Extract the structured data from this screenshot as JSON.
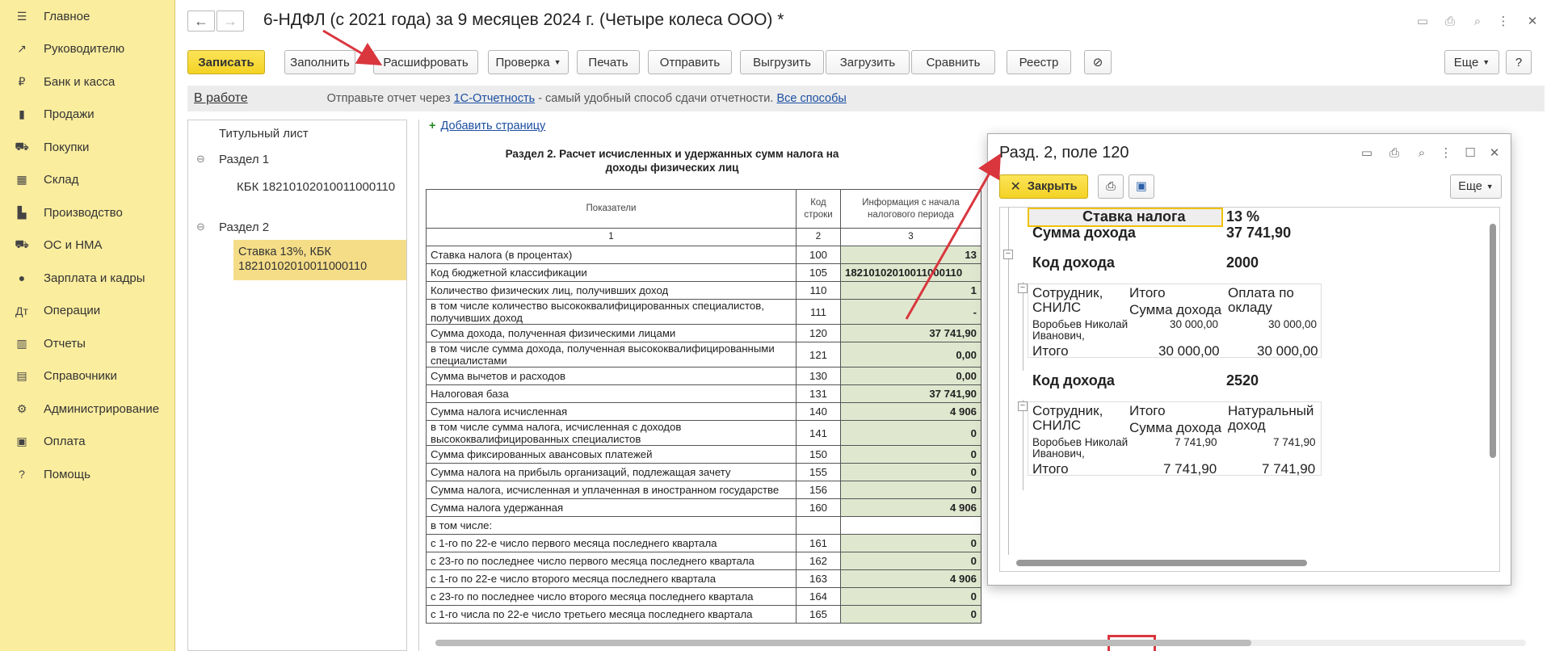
{
  "nav": {
    "items": [
      {
        "icon": "menu-icon",
        "glyph": "☰",
        "label": "Главное"
      },
      {
        "icon": "trend-icon",
        "glyph": "↗",
        "label": "Руководителю"
      },
      {
        "icon": "bank-icon",
        "glyph": "₽",
        "label": "Банк и касса"
      },
      {
        "icon": "shopping-bag-icon",
        "glyph": "▮",
        "label": "Продажи"
      },
      {
        "icon": "cart-icon",
        "glyph": "⛟",
        "label": "Покупки"
      },
      {
        "icon": "warehouse-icon",
        "glyph": "▦",
        "label": "Склад"
      },
      {
        "icon": "factory-icon",
        "glyph": "▙",
        "label": "Производство"
      },
      {
        "icon": "truck-icon",
        "glyph": "⛟",
        "label": "ОС и НМА"
      },
      {
        "icon": "person-icon",
        "glyph": "●",
        "label": "Зарплата и кадры"
      },
      {
        "icon": "operations-icon",
        "glyph": "Дт",
        "label": "Операции"
      },
      {
        "icon": "reports-icon",
        "glyph": "▥",
        "label": "Отчеты"
      },
      {
        "icon": "books-icon",
        "glyph": "▤",
        "label": "Справочники"
      },
      {
        "icon": "gear-icon",
        "glyph": "⚙",
        "label": "Администрирование"
      },
      {
        "icon": "payment-icon",
        "glyph": "▣",
        "label": "Оплата"
      },
      {
        "icon": "help-icon",
        "glyph": "?",
        "label": "Помощь"
      }
    ]
  },
  "header": {
    "title": "6-НДФЛ (с 2021 года) за 9 месяцев 2024 г. (Четыре колеса ООО) *"
  },
  "toolbar": {
    "save": "Записать",
    "fill": "Заполнить",
    "decode": "Расшифровать",
    "check": "Проверка",
    "print": "Печать",
    "send": "Отправить",
    "export": "Выгрузить",
    "import": "Загрузить",
    "compare": "Сравнить",
    "registry": "Реестр",
    "more": "Еще",
    "help": "?"
  },
  "infobar": {
    "status": "В работе",
    "msg_before": "Отправьте отчет через ",
    "link1": "1С-Отчетность",
    "msg_after": " - самый удобный способ сдачи отчетности. ",
    "link2": "Все способы"
  },
  "tree": {
    "title_page": "Титульный лист",
    "section1": "Раздел 1",
    "kbk1": "КБК 18210102010011000110",
    "section2": "Раздел 2",
    "sel_line1": "Ставка 13%, КБК",
    "sel_line2": "18210102010011000110"
  },
  "report": {
    "add_page": "Добавить страницу",
    "title": "Раздел 2. Расчет исчисленных и удержанных сумм налога на доходы физических лиц",
    "head": {
      "c1": "Показатели",
      "c2": "Код строки",
      "c3": "Информация с начала налогового периода",
      "n1": "1",
      "n2": "2",
      "n3": "3"
    },
    "rows": [
      {
        "label": "Ставка налога (в процентах)",
        "code": "100",
        "value": "13"
      },
      {
        "label": "Код бюджетной классификации",
        "code": "105",
        "value": "18210102010011000110"
      },
      {
        "label": "Количество физических лиц, получивших доход",
        "code": "110",
        "value": "1"
      },
      {
        "label": "в том числе количество высококвалифицированных специалистов, получивших доход",
        "code": "111",
        "value": "-"
      },
      {
        "label": "Сумма дохода, полученная физическими лицами",
        "code": "120",
        "value": "37 741,90"
      },
      {
        "label": "в том числе сумма дохода, полученная высококвалифицированными специалистами",
        "code": "121",
        "value": "0,00"
      },
      {
        "label": "Сумма вычетов и расходов",
        "code": "130",
        "value": "0,00"
      },
      {
        "label": "Налоговая база",
        "code": "131",
        "value": "37 741,90"
      },
      {
        "label": "Сумма налога исчисленная",
        "code": "140",
        "value": "4 906"
      },
      {
        "label": "в том числе сумма налога, исчисленная с доходов высококвалифицированных специалистов",
        "code": "141",
        "value": "0"
      },
      {
        "label": "Сумма фиксированных авансовых платежей",
        "code": "150",
        "value": "0"
      },
      {
        "label": "Сумма налога на прибыль организаций, подлежащая зачету",
        "code": "155",
        "value": "0"
      },
      {
        "label": "Сумма налога, исчисленная и уплаченная в иностранном государстве",
        "code": "156",
        "value": "0"
      },
      {
        "label": "Сумма налога удержанная",
        "code": "160",
        "value": "4 906"
      },
      {
        "label": "в том числе:",
        "code": "",
        "value": ""
      },
      {
        "label": "с 1-го по 22-е число первого месяца последнего квартала",
        "code": "161",
        "value": "0"
      },
      {
        "label": "с 23-го по последнее число первого месяца последнего квартала",
        "code": "162",
        "value": "0"
      },
      {
        "label": "с 1-го по 22-е число второго месяца последнего квартала",
        "code": "163",
        "value": "4 906"
      },
      {
        "label": "с 23-го по последнее число второго месяца последнего квартала",
        "code": "164",
        "value": "0"
      },
      {
        "label": "с 1-го числа по 22-е число третьего месяца последнего квартала",
        "code": "165",
        "value": "0"
      }
    ]
  },
  "popup": {
    "title": "Разд. 2, поле 120",
    "close": "Закрыть",
    "more": "Еще",
    "rate_label": "Ставка налога",
    "rate_value": "13 %",
    "income_sum_label": "Сумма дохода",
    "income_sum_value": "37 741,90",
    "income_code_label": "Код дохода",
    "groups": [
      {
        "code": "2000",
        "col1a": "Сотрудник,",
        "col1b": "СНИЛС",
        "col2a": "Итого",
        "col2b": "Сумма дохода",
        "col3a": "Оплата по",
        "col3b": "окладу",
        "emp_a": "Воробьев Николай",
        "emp_b": "Иванович,",
        "emp_total": "30 000,00",
        "emp_col3": "30 000,00",
        "total_label": "Итого",
        "total_sum": "30 000,00",
        "total_col3": "30 000,00"
      },
      {
        "code": "2520",
        "col1a": "Сотрудник,",
        "col1b": "СНИЛС",
        "col2a": "Итого",
        "col2b": "Сумма дохода",
        "col3a": "Натуральный",
        "col3b": "доход",
        "emp_a": "Воробьев Николай",
        "emp_b": "Иванович,",
        "emp_total": "7 741,90",
        "emp_col3": "7 741,90",
        "total_label": "Итого",
        "total_sum": "7 741,90",
        "total_col3": "7 741,90"
      }
    ]
  },
  "colors": {
    "nav_bg": "#fbed9e",
    "accent": "#f4d224",
    "highlight": "#d9363e",
    "cell_bg": "#dfe8cf"
  }
}
